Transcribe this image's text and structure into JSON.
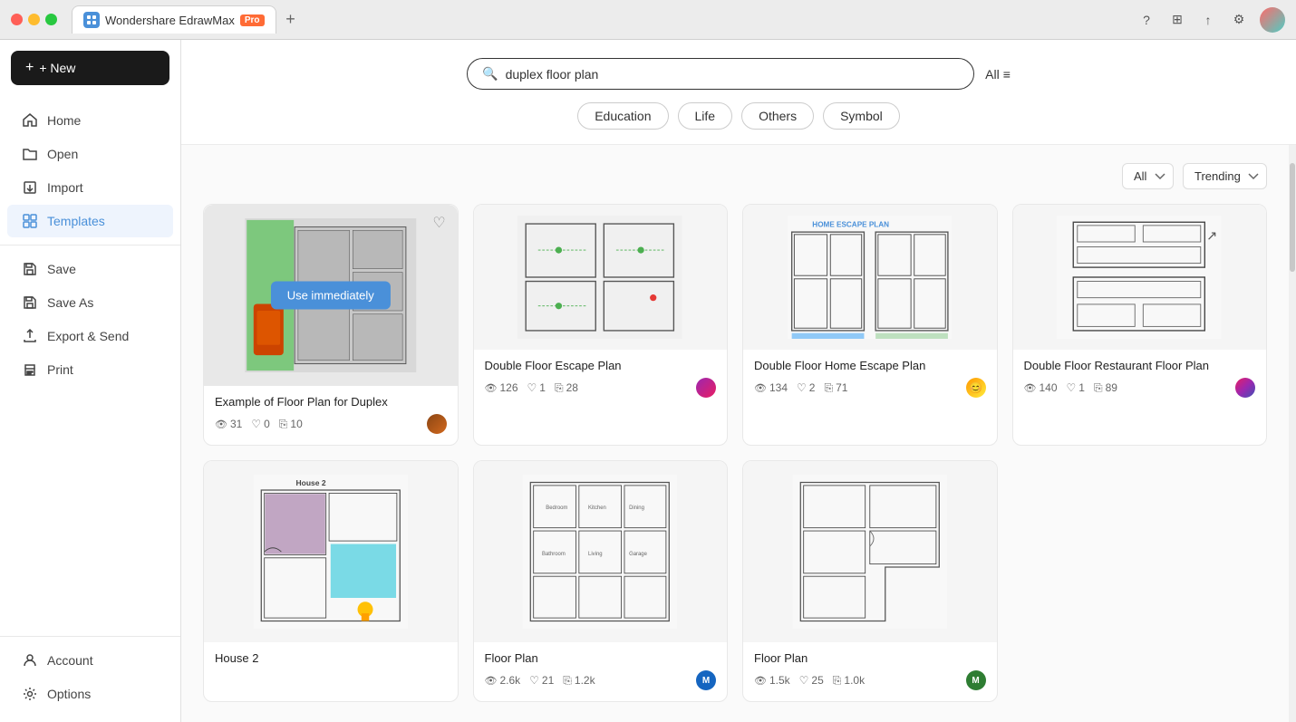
{
  "titlebar": {
    "app_name": "Wondershare EdrawMax",
    "pro_label": "Pro",
    "add_tab": "+"
  },
  "sidebar": {
    "new_label": "+ New",
    "items": [
      {
        "id": "home",
        "label": "Home",
        "icon": "home"
      },
      {
        "id": "open",
        "label": "Open",
        "icon": "folder"
      },
      {
        "id": "import",
        "label": "Import",
        "icon": "import"
      },
      {
        "id": "templates",
        "label": "Templates",
        "icon": "templates",
        "active": true
      },
      {
        "id": "save",
        "label": "Save",
        "icon": "save"
      },
      {
        "id": "save-as",
        "label": "Save As",
        "icon": "save-as"
      },
      {
        "id": "export",
        "label": "Export & Send",
        "icon": "export"
      },
      {
        "id": "print",
        "label": "Print",
        "icon": "print"
      }
    ],
    "bottom_items": [
      {
        "id": "account",
        "label": "Account",
        "icon": "account"
      },
      {
        "id": "options",
        "label": "Options",
        "icon": "options"
      }
    ]
  },
  "search": {
    "placeholder": "duplex floor plan",
    "value": "duplex floor plan",
    "all_label": "All",
    "chips": [
      "Education",
      "Life",
      "Others",
      "Symbol"
    ]
  },
  "filters": {
    "category_label": "All",
    "sort_label": "Trending"
  },
  "templates": [
    {
      "id": 1,
      "title": "Example of Floor Plan for Duplex",
      "views": "31",
      "likes": "0",
      "copies": "10",
      "featured": true,
      "use_btn": "Use immediately"
    },
    {
      "id": 2,
      "title": "Double Floor Escape Plan",
      "views": "126",
      "likes": "1",
      "copies": "28"
    },
    {
      "id": 3,
      "title": "Double Floor Home Escape Plan",
      "views": "134",
      "likes": "2",
      "copies": "71"
    },
    {
      "id": 4,
      "title": "Double Floor Restaurant Floor Plan",
      "views": "140",
      "likes": "1",
      "copies": "89"
    },
    {
      "id": 5,
      "title": "House 2",
      "views": "",
      "likes": "",
      "copies": ""
    },
    {
      "id": 6,
      "title": "Floor Plan",
      "views": "2.6k",
      "likes": "21",
      "copies": "1.2k"
    },
    {
      "id": 7,
      "title": "Floor Plan",
      "views": "1.5k",
      "likes": "25",
      "copies": "1.0k"
    }
  ],
  "colors": {
    "accent": "#4a90d9",
    "new_btn_bg": "#1a1a1a",
    "active_nav": "#4a90d9",
    "chip_border": "#cccccc"
  }
}
